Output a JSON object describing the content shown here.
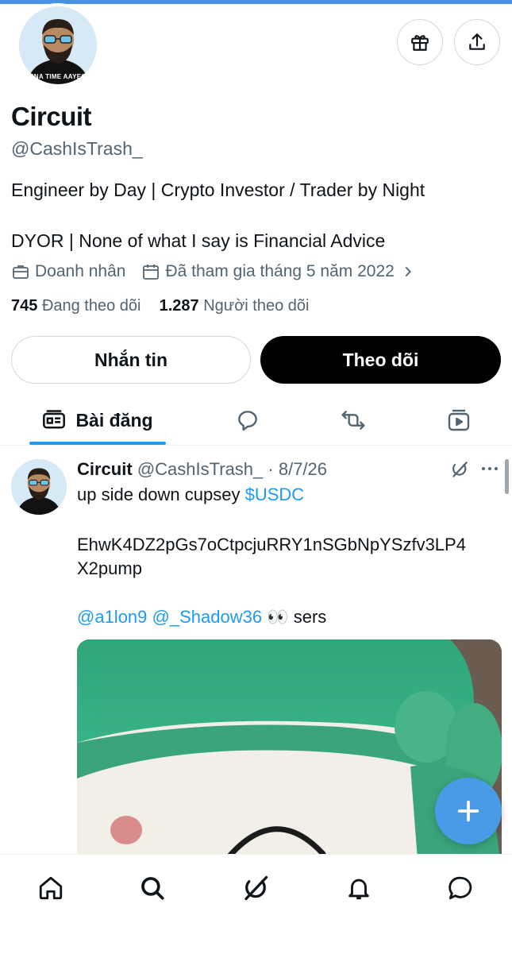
{
  "profile": {
    "name": "Circuit",
    "handle": "@CashIsTrash_",
    "bio_line1": "Engineer by Day | Crypto Investor / Trader by Night",
    "bio_line2": "DYOR | None of what I say is Financial Advice",
    "avatar_caption": "APNA TIME AAYEGA",
    "category": "Doanh nhân",
    "joined": "Đã tham gia tháng 5 năm 2022",
    "following_count": "745",
    "following_label": "Đang theo dõi",
    "followers_count": "1.287",
    "followers_label": "Người theo dõi"
  },
  "actions": {
    "message_label": "Nhắn tin",
    "follow_label": "Theo dõi"
  },
  "tabs": {
    "posts_label": "Bài đăng"
  },
  "post": {
    "author": "Circuit",
    "handle": "@CashIsTrash_",
    "separator": " · ",
    "date": "8/7/26",
    "line1_text": "up side down cupsey ",
    "line1_cashtag": "$USDC",
    "address_line1": "EhwK4DZ2pGs7oCtpcjuRRY1nSGbNpYSzfv3LP4",
    "address_line2": "X2pump",
    "mention1": "@a1lon9",
    "mention2": "@_Shadow36",
    "emoji": "👀",
    "tail": " sers"
  },
  "icons": {
    "header": [
      "gift-icon",
      "share-icon"
    ],
    "tabs": [
      "posts-icon",
      "replies-icon",
      "repost-icon",
      "media-icon"
    ],
    "bottom_nav": [
      "home-icon",
      "search-icon",
      "grok-icon",
      "notifications-icon",
      "messages-icon"
    ]
  },
  "colors": {
    "accent": "#1d9bf0",
    "fab": "#4a9be6",
    "text": "#0f1419",
    "secondary": "#536471"
  }
}
